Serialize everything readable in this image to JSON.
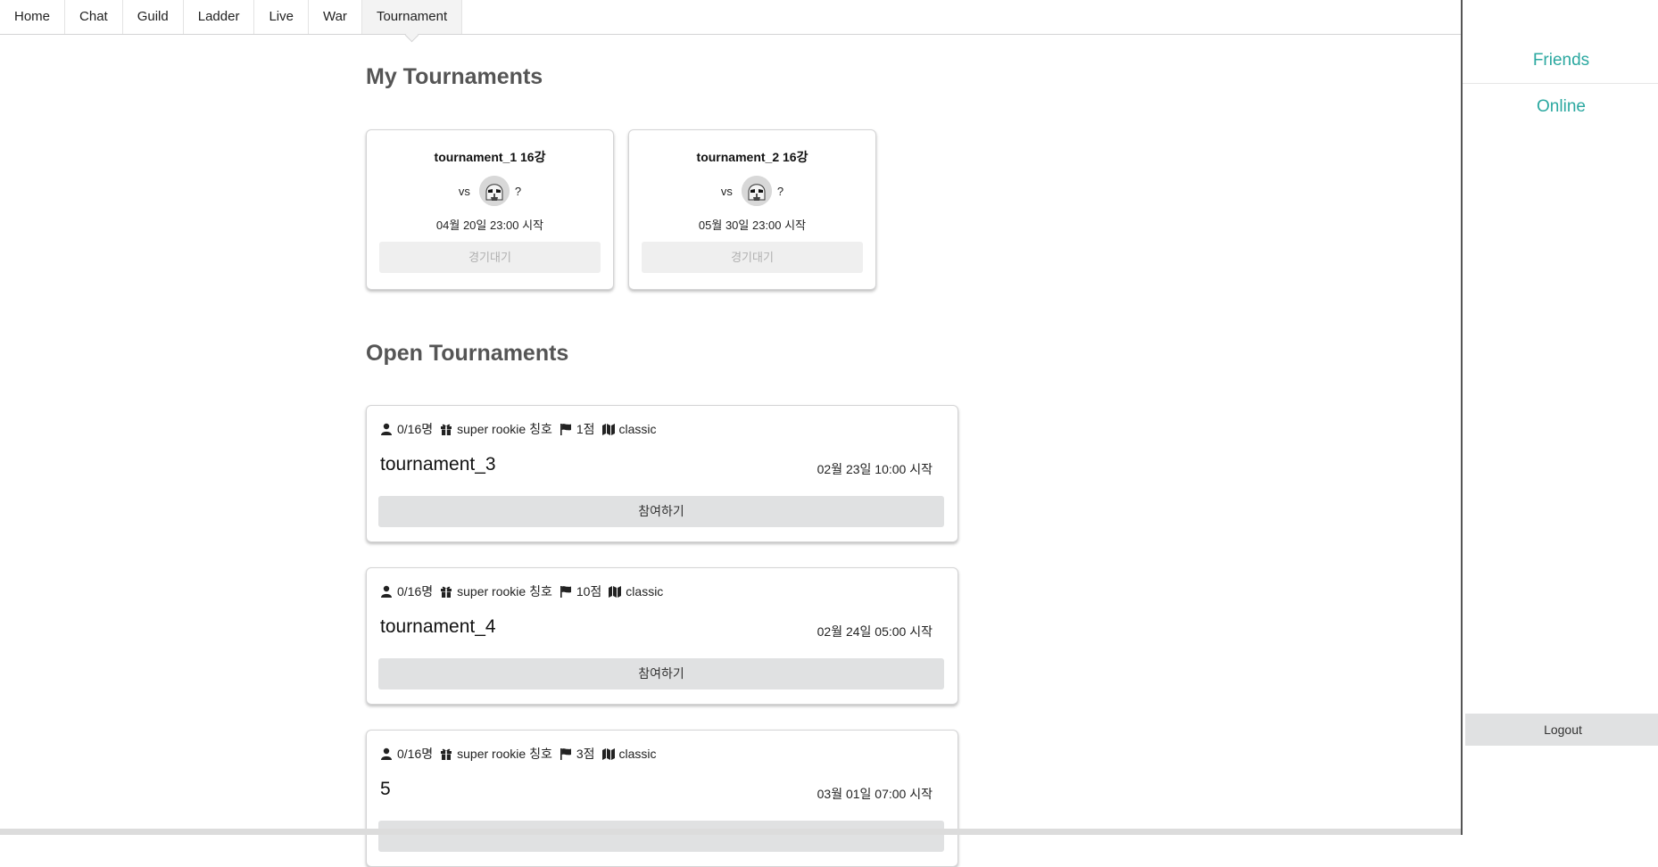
{
  "nav": {
    "items": [
      {
        "label": "Home"
      },
      {
        "label": "Chat"
      },
      {
        "label": "Guild"
      },
      {
        "label": "Ladder"
      },
      {
        "label": "Live"
      },
      {
        "label": "War"
      },
      {
        "label": "Tournament"
      }
    ],
    "active": "Tournament"
  },
  "sidebar": {
    "friends_label": "Friends",
    "online_label": "Online",
    "logout_label": "Logout",
    "accent_color": "#2ba8a0"
  },
  "my_tournaments": {
    "title": "My Tournaments",
    "cards": [
      {
        "title": "tournament_1 16강",
        "vs": "vs",
        "opponent": "?",
        "avatar_icon": "stormtrooper-avatar",
        "date": "04월 20일 23:00 시작",
        "button": "경기대기"
      },
      {
        "title": "tournament_2 16강",
        "vs": "vs",
        "opponent": "?",
        "avatar_icon": "stormtrooper-avatar",
        "date": "05월 30일 23:00 시작",
        "button": "경기대기"
      }
    ]
  },
  "open_tournaments": {
    "title": "Open Tournaments",
    "cards": [
      {
        "players": "0/16명",
        "reward": "super rookie 칭호",
        "score": "1점",
        "map": "classic",
        "name": "tournament_3",
        "date": "02월 23일 10:00 시작",
        "button": "참여하기"
      },
      {
        "players": "0/16명",
        "reward": "super rookie 칭호",
        "score": "10점",
        "map": "classic",
        "name": "tournament_4",
        "date": "02월 24일 05:00 시작",
        "button": "참여하기"
      },
      {
        "players": "0/16명",
        "reward": "super rookie 칭호",
        "score": "3점",
        "map": "classic",
        "name": "5",
        "date": "03월 01일 07:00 시작",
        "button": ""
      }
    ]
  }
}
